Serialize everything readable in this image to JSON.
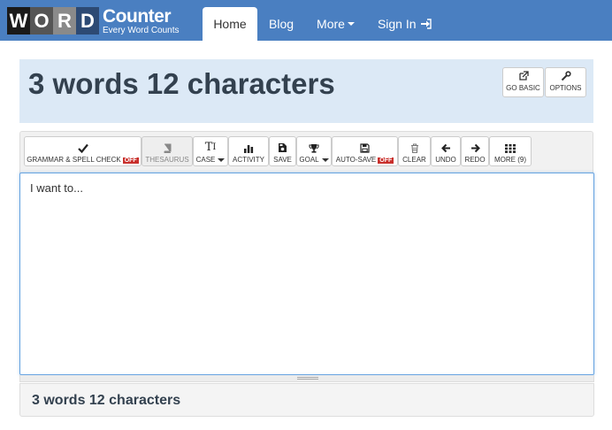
{
  "logo": {
    "letters": [
      "W",
      "O",
      "R",
      "D"
    ],
    "letter_colors": [
      "#1a1a1a",
      "#555555",
      "#8a8a8a",
      "#2d4a74"
    ],
    "title": "Counter",
    "subtitle": "Every Word Counts"
  },
  "nav": {
    "home": "Home",
    "blog": "Blog",
    "more": "More",
    "sign_in": "Sign In"
  },
  "header": {
    "title": "3 words 12 characters",
    "go_basic": "GO BASIC",
    "options": "OPTIONS"
  },
  "toolbar": {
    "grammar": "GRAMMAR & SPELL CHECK",
    "grammar_state": "OFF",
    "thesaurus": "THESAURUS",
    "case": "CASE",
    "activity": "ACTIVITY",
    "save": "SAVE",
    "goal": "GOAL",
    "autosave": "AUTO-SAVE",
    "autosave_state": "OFF",
    "clear": "CLEAR",
    "undo": "UNDO",
    "redo": "REDO",
    "more": "MORE (9)"
  },
  "editor": {
    "text": "I want to..."
  },
  "footer": {
    "stats": "3 words 12 characters"
  },
  "colors": {
    "navbar": "#4a7fc1",
    "header_panel": "#dce9f6",
    "off_badge": "#c9302c",
    "title_text": "#33414f"
  }
}
